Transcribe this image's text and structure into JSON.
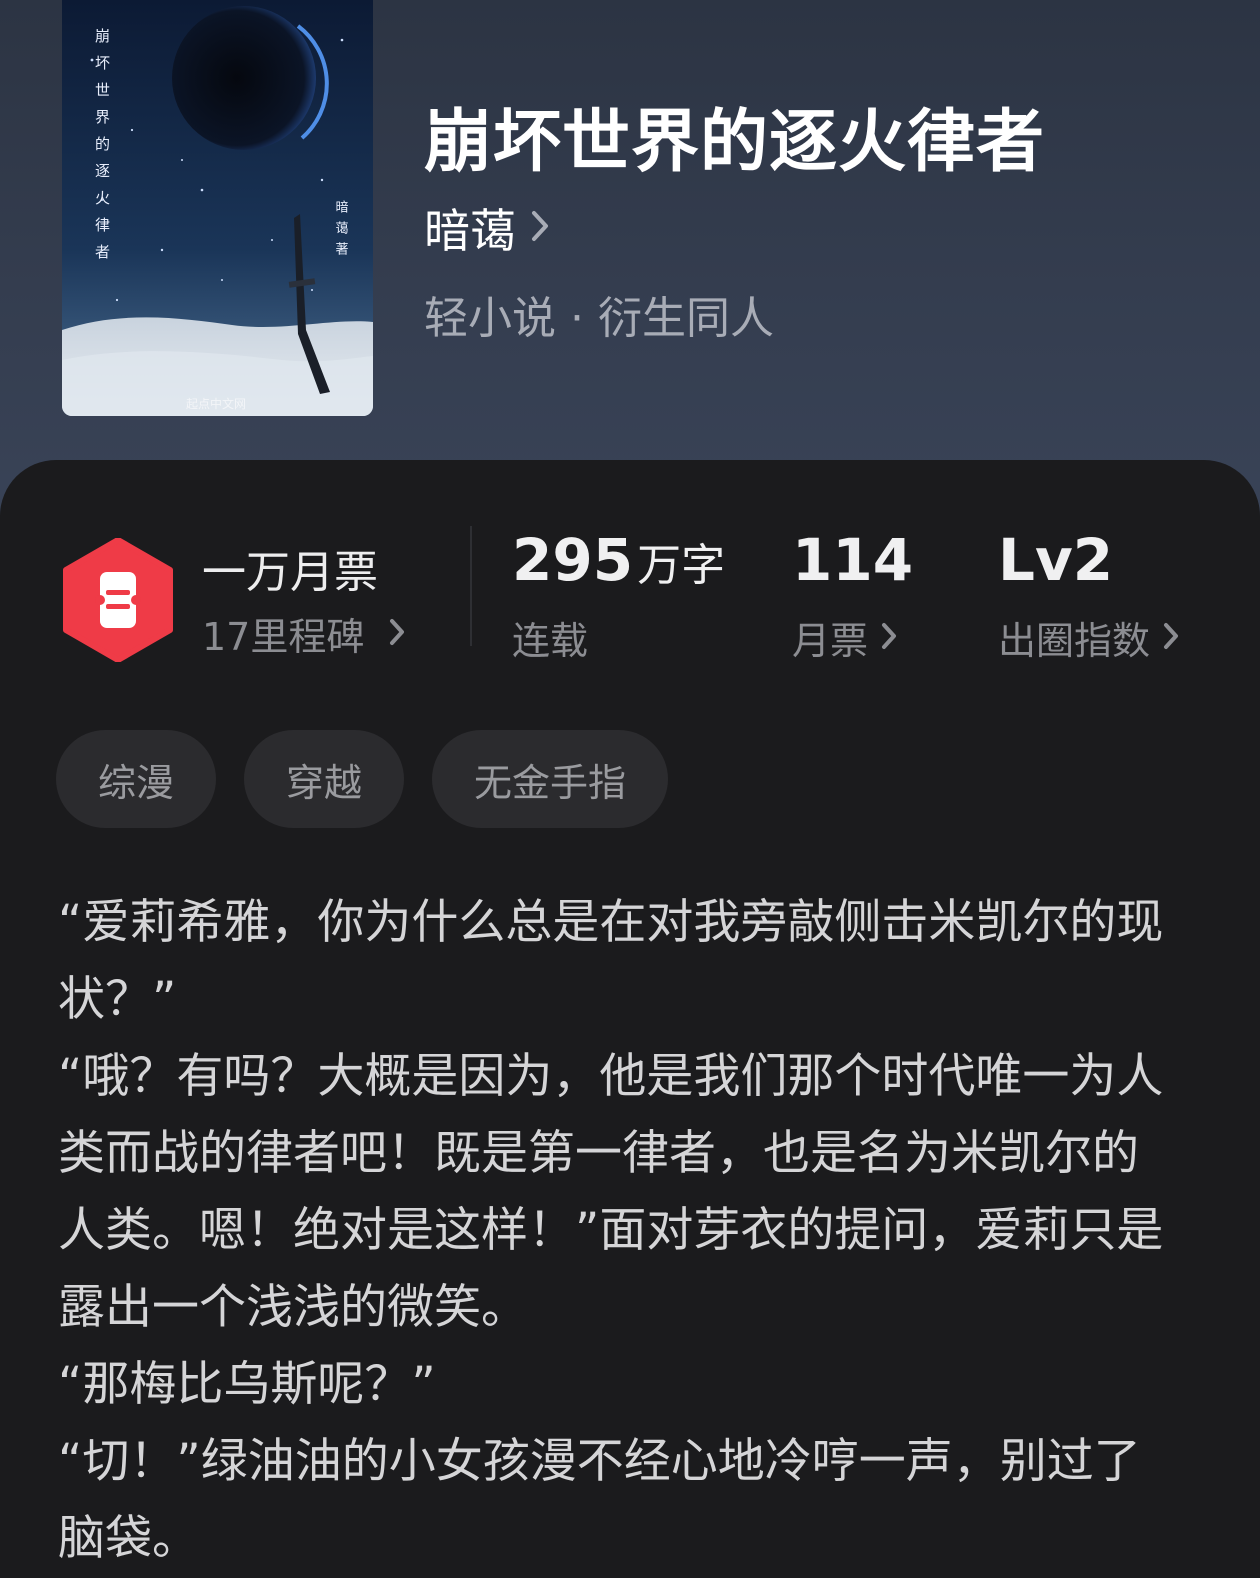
{
  "book": {
    "title": "崩坏世界的逐火律者",
    "author": "暗蔼",
    "category": "轻小说 · 衍生同人",
    "cover": {
      "vertical_title": "崩坏世界的逐火律者",
      "vertical_author": "暗蔼著",
      "publisher_mark": "起点中文网"
    }
  },
  "stats": {
    "monthly_ticket_tier": "一万月票",
    "milestones": "17里程碑",
    "word_count_number": "295",
    "word_count_unit": "万字",
    "status": "连载",
    "monthly_tickets": "114",
    "monthly_tickets_label": "月票",
    "level": "Lv2",
    "level_label": "出圈指数"
  },
  "tags": [
    "综漫",
    "穿越",
    "无金手指"
  ],
  "synopsis": [
    "“爱莉希雅，你为什么总是在对我旁敲侧击米凯尔的现状？”",
    "“哦？有吗？大概是因为，他是我们那个时代唯一为人类而战的律者吧！既是第一律者，也是名为米凯尔的人类。嗯！绝对是这样！”面对芽衣的提问，爱莉只是露出一个浅浅的微笑。",
    "“那梅比乌斯呢？”",
    "“切！”绿油油的小女孩漫不经心地冷哼一声，别过了脑袋。"
  ],
  "colors": {
    "hero_bg": "#343d4f",
    "panel_bg": "#1b1b1d",
    "badge_red": "#ef3b47",
    "tag_bg": "#2b2b2e"
  },
  "icons": {
    "chevron": "chevron-right-icon",
    "badge": "ticket-badge-icon"
  }
}
